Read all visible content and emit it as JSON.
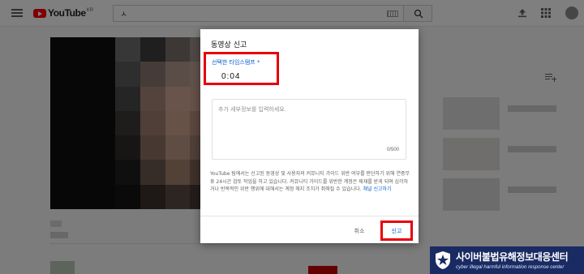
{
  "header": {
    "logo_text": "YouTube",
    "logo_region": "KR",
    "search_value": "ㅅ",
    "icons": [
      "menu-icon",
      "keyboard-icon",
      "search-icon",
      "upload-icon",
      "apps-icon",
      "avatar"
    ]
  },
  "dialog": {
    "title": "동영상 신고",
    "timestamp_label": "선택한 타임스탬프 *",
    "timestamp_value": "0:04",
    "details_placeholder": "추가 세부정보를 입력하세요.",
    "char_counter": "0/500",
    "notice_text": "YouTube 팀에서는 신고된 동영상 및 사용자의 커뮤니티 가이드 위반 여부를 판단하기 위해 연중무휴 24시간 검토 작업을 하고 있습니다. 커뮤니티 가이드를 위반한 계정은 제재를 받게 되며 심각하거나 반복적인 위반 행위에 대해서는 계정 해지 조치가 취해질 수 있습니다.",
    "notice_link": "채널 신고하기",
    "cancel_label": "취소",
    "report_label": "신고"
  },
  "watermark": {
    "title": "사이버불법유해정보대응센터",
    "subtitle": "cyber illegal harmful information response center"
  },
  "colors": {
    "highlight": "#e8000b",
    "link_blue": "#065fd4",
    "brand_red": "#ff0000",
    "watermark_bg": "#1a2b63"
  }
}
